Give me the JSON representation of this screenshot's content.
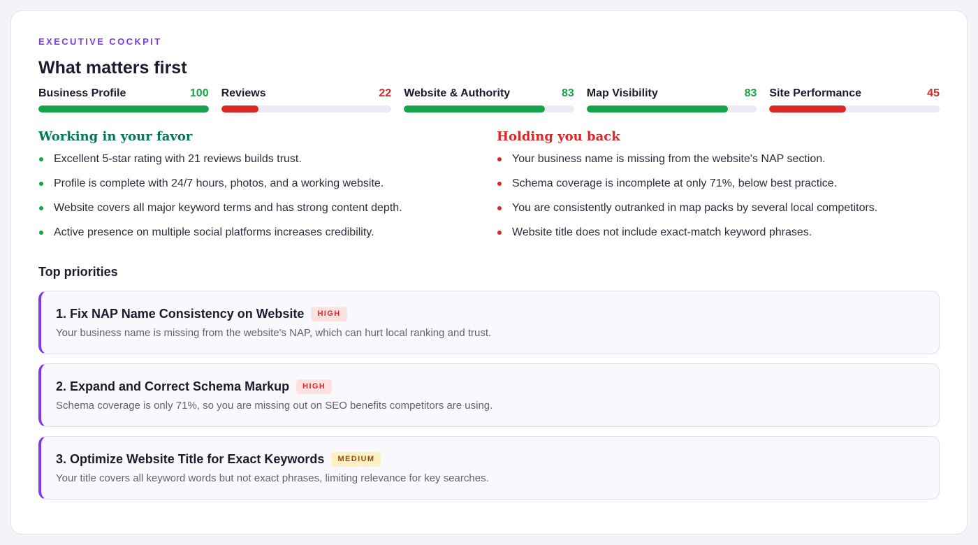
{
  "header": {
    "eyebrow": "EXECUTIVE COCKPIT",
    "title": "What matters first"
  },
  "metrics": [
    {
      "label": "Business Profile",
      "score": "100",
      "value": 100,
      "status": "good"
    },
    {
      "label": "Reviews",
      "score": "22",
      "value": 22,
      "status": "bad"
    },
    {
      "label": "Website & Authority",
      "score": "83",
      "value": 83,
      "status": "good"
    },
    {
      "label": "Map Visibility",
      "score": "83",
      "value": 83,
      "status": "good"
    },
    {
      "label": "Site Performance",
      "score": "45",
      "value": 45,
      "status": "bad"
    }
  ],
  "favor": {
    "title": "Working in your favor",
    "items": [
      "Excellent 5-star rating with 21 reviews builds trust.",
      "Profile is complete with 24/7 hours, photos, and a working website.",
      "Website covers all major keyword terms and has strong content depth.",
      "Active presence on multiple social platforms increases credibility."
    ]
  },
  "back": {
    "title": "Holding you back",
    "items": [
      "Your business name is missing from the website's NAP section.",
      "Schema coverage is incomplete at only 71%, below best practice.",
      "You are consistently outranked in map packs by several local competitors.",
      "Website title does not include exact-match keyword phrases."
    ]
  },
  "priorities": {
    "title": "Top priorities",
    "items": [
      {
        "name": "1. Fix NAP Name Consistency on Website",
        "badge": "HIGH",
        "level": "high",
        "desc": "Your business name is missing from the website's NAP, which can hurt local ranking and trust."
      },
      {
        "name": "2. Expand and Correct Schema Markup",
        "badge": "HIGH",
        "level": "high",
        "desc": "Schema coverage is only 71%, so you are missing out on SEO benefits competitors are using."
      },
      {
        "name": "3. Optimize Website Title for Exact Keywords",
        "badge": "MEDIUM",
        "level": "medium",
        "desc": "Your title covers all keyword words but not exact phrases, limiting relevance for key searches."
      }
    ]
  },
  "colors": {
    "accent": "#7c3aed",
    "good": "#16a34a",
    "bad": "#dc2626",
    "favor_heading": "#047857"
  }
}
